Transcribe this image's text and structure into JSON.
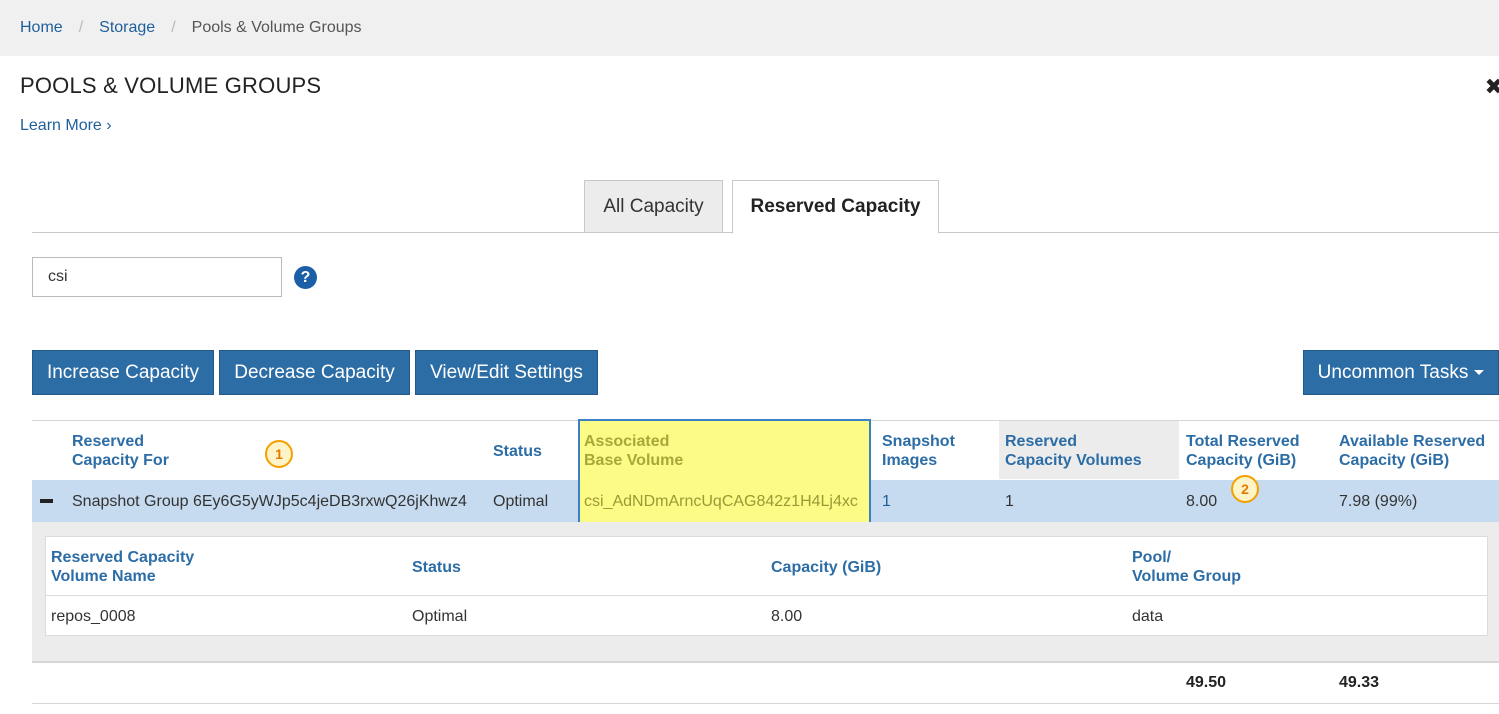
{
  "breadcrumb": {
    "items": [
      "Home",
      "Storage"
    ],
    "current": "Pools & Volume Groups"
  },
  "page": {
    "title": "POOLS & VOLUME GROUPS",
    "learn_more": "Learn More",
    "close_glyph": "✖"
  },
  "tabs": [
    {
      "label": "All Capacity",
      "active": false
    },
    {
      "label": "Reserved Capacity",
      "active": true
    }
  ],
  "filter": {
    "value": "csi",
    "help_glyph": "?"
  },
  "toolbar": {
    "increase": "Increase Capacity",
    "decrease": "Decrease Capacity",
    "view_edit": "View/Edit Settings",
    "uncommon": "Uncommon Tasks"
  },
  "table": {
    "headers": {
      "reserved_for_1": "Reserved",
      "reserved_for_2": "Capacity For",
      "status": "Status",
      "assoc_1": "Associated",
      "assoc_2": "Base Volume",
      "snap_1": "Snapshot",
      "snap_2": "Images",
      "rcv_1": "Reserved",
      "rcv_2": "Capacity Volumes",
      "total_1": "Total Reserved",
      "total_2": "Capacity (GiB)",
      "avail_1": "Available Reserved",
      "avail_2": "Capacity (GiB)"
    },
    "row": {
      "reserved_for": "Snapshot Group 6Ey6G5yWJp5c4jeDB3rxwQ26jKhwz4",
      "status": "Optimal",
      "base_volume": "csi_AdNDmArncUqCAG842z1H4Lj4xc",
      "snapshot_images": "1",
      "reserved_capacity_volumes": "1",
      "total_reserved": "8.00",
      "available_reserved": "7.98 (99%)"
    },
    "totals": {
      "total_reserved": "49.50",
      "available_reserved": "49.33"
    }
  },
  "detail": {
    "headers": {
      "name_1": "Reserved Capacity",
      "name_2": "Volume Name",
      "status": "Status",
      "capacity": "Capacity (GiB)",
      "pool_1": "Pool/",
      "pool_2": "Volume Group"
    },
    "row": {
      "name": "repos_0008",
      "status": "Optimal",
      "capacity": "8.00",
      "pool": "data"
    }
  },
  "callouts": [
    "1",
    "2"
  ],
  "colors": {
    "primary_button": "#2d6da6",
    "link": "#1f5f9c",
    "selected_row": "#c6dbef",
    "highlight": "#fbfb86",
    "callout": "#f5a000"
  }
}
